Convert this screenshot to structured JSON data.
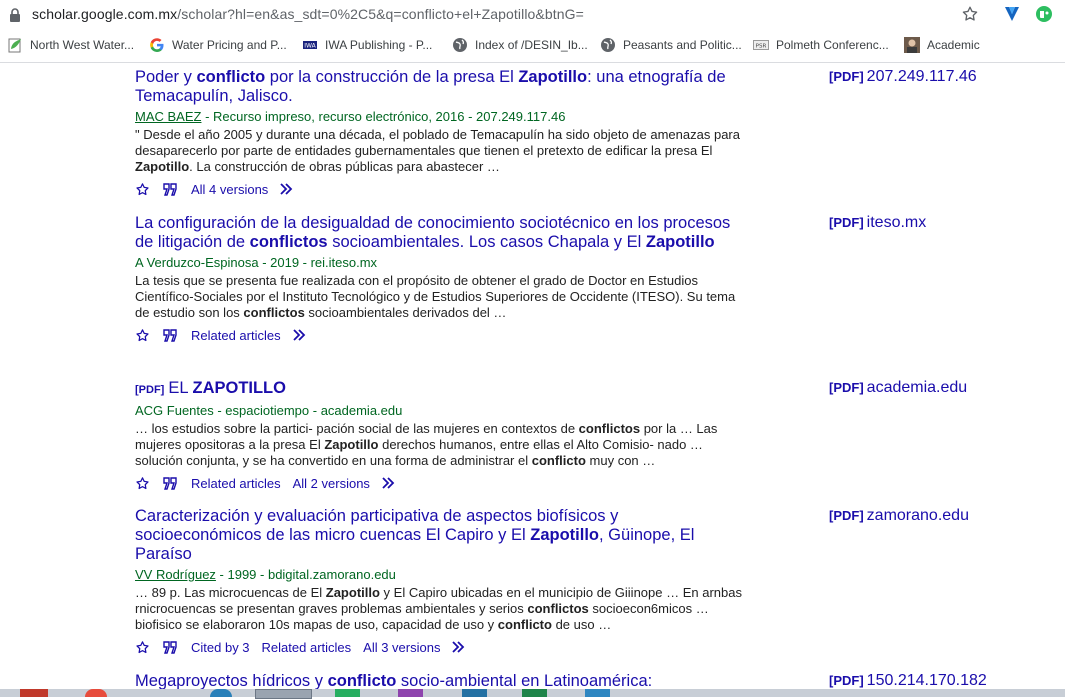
{
  "browser": {
    "url_host": "scholar.google.com.mx",
    "url_path": "/scholar?hl=en&as_sdt=0%2C5&q=conflicto+el+Zapotillo&btnG="
  },
  "bookmarks": [
    {
      "label": "North West Water...",
      "icon": "leaf-doc-icon"
    },
    {
      "label": "Water Pricing and P...",
      "icon": "google-g-icon"
    },
    {
      "label": "IWA Publishing - P...",
      "icon": "iwa-icon"
    },
    {
      "label": "Index of /DESIN_Ib...",
      "icon": "globe-icon"
    },
    {
      "label": "Peasants and Politic...",
      "icon": "globe-icon"
    },
    {
      "label": "Polmeth Conferenc...",
      "icon": "psr-icon"
    },
    {
      "label": "Academic",
      "icon": "academic-photo-icon"
    }
  ],
  "results": [
    {
      "title_parts": [
        "Poder y ",
        "conflicto",
        " por la construcción de la presa El ",
        "Zapotillo",
        ": una etnografía de Temacapulín, Jalisco."
      ],
      "author": "MAC BAEZ",
      "meta_rest": " - Recurso impreso, recurso electrónico, 2016 - 207.249.117.46",
      "snippet_parts": [
        "\" Desde el año 2005 y durante una década, el poblado de Temacapulín ha sido objeto de amenazas para desaparecerlo por parte de entidades gubernamentales que tienen el pretexto de edificar la presa El ",
        "Zapotillo",
        ". La construcción de obras públicas para abastecer …"
      ],
      "actions": [
        "All 4 versions"
      ],
      "side_tag": "[PDF]",
      "side_host": "207.249.117.46"
    },
    {
      "title_parts": [
        "La configuración de la desigualdad de conocimiento sociotécnico en los procesos de litigación de ",
        "conflictos",
        " socioambientales. Los casos Chapala y El ",
        "Zapotillo",
        ""
      ],
      "author": "",
      "meta_rest": "A Verduzco-Espinosa - 2019 - rei.iteso.mx",
      "snippet_parts": [
        "La tesis que se presenta fue realizada con el propósito de obtener el grado de Doctor en Estudios Científico-Sociales por el Instituto Tecnológico y de Estudios Superiores de Occidente (ITESO). Su tema de estudio son los ",
        "conflictos",
        " socioambientales derivados del …"
      ],
      "actions": [
        "Related articles"
      ],
      "side_tag": "[PDF]",
      "side_host": "iteso.mx"
    },
    {
      "title_tag": "[PDF]",
      "title_parts": [
        "EL ",
        "ZAPOTILLO",
        ""
      ],
      "author": "",
      "meta_rest": "ACG Fuentes - espaciotiempo - academia.edu",
      "snippet_parts": [
        "… los estudios sobre la partici- pación social de las mujeres en contextos de ",
        "conflictos",
        " por la … Las mujeres opositoras a la presa El ",
        "Zapotillo",
        " derechos humanos, entre ellas el Alto Comisio- nado … solución conjunta, y se ha convertido en una forma de administrar el ",
        "conflicto",
        " muy con …"
      ],
      "actions": [
        "Related articles",
        "All 2 versions"
      ],
      "side_tag": "[PDF]",
      "side_host": "academia.edu"
    },
    {
      "title_parts": [
        "Caracterización y evaluación participativa de aspectos biofísicos y socioeconómicos de las micro cuencas El Capiro y El ",
        "Zapotillo",
        ", Güinope, El Paraíso"
      ],
      "author": "VV Rodríguez",
      "meta_rest": " - 1999 - bdigital.zamorano.edu",
      "snippet_parts": [
        "… 89 p. Las microcuencas de El ",
        "Zapotillo",
        " y El Capiro ubicadas en el municipio de Giiinope … En arnbas rnicrocuencas se presentan graves problemas ambientales y serios ",
        "conflictos",
        " socioecon6micos … biofisico se elaboraron 10s mapas de uso, capacidad de uso y ",
        "conflicto",
        " de uso …"
      ],
      "actions": [
        "Cited by 3",
        "Related articles",
        "All 3 versions"
      ],
      "side_tag": "[PDF]",
      "side_host": "zamorano.edu"
    },
    {
      "title_parts": [
        "Megaproyectos hídricos y ",
        "conflicto",
        " socio-ambiental en Latinoamérica:"
      ],
      "author": "",
      "meta_rest": "",
      "snippet_parts": [],
      "actions": [],
      "side_tag": "[PDF]",
      "side_host": "150.214.170.182"
    }
  ],
  "colors": {
    "link": "#1a0dab",
    "meta_green": "#006621",
    "snippet": "#222222"
  }
}
